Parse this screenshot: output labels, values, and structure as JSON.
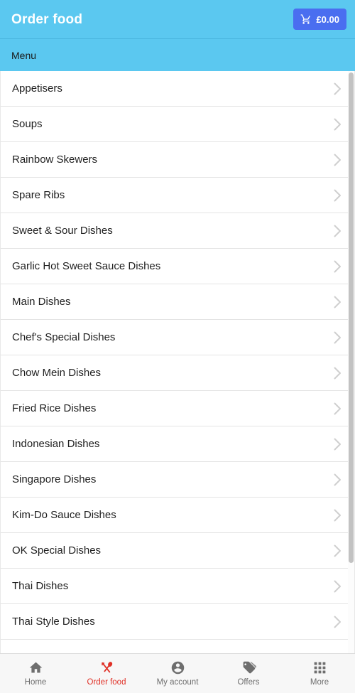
{
  "header": {
    "title": "Order food",
    "cart": {
      "icon": "shopping-cart-icon",
      "amount": "£0.00",
      "background_color": "#4a6ef0"
    },
    "background_color": "#5bc8f0"
  },
  "menu_bar": {
    "label": "Menu",
    "background_color": "#5bc8f0"
  },
  "categories": [
    {
      "label": "Appetisers",
      "chevron": "chevron-right-icon"
    },
    {
      "label": "Soups",
      "chevron": "chevron-right-icon"
    },
    {
      "label": "Rainbow Skewers",
      "chevron": "chevron-right-icon"
    },
    {
      "label": "Spare Ribs",
      "chevron": "chevron-right-icon"
    },
    {
      "label": "Sweet & Sour Dishes",
      "chevron": "chevron-right-icon"
    },
    {
      "label": "Garlic Hot Sweet Sauce Dishes",
      "chevron": "chevron-right-icon"
    },
    {
      "label": "Main Dishes",
      "chevron": "chevron-right-icon"
    },
    {
      "label": "Chef's Special Dishes",
      "chevron": "chevron-right-icon"
    },
    {
      "label": "Chow Mein Dishes",
      "chevron": "chevron-right-icon"
    },
    {
      "label": "Fried Rice Dishes",
      "chevron": "chevron-right-icon"
    },
    {
      "label": "Indonesian Dishes",
      "chevron": "chevron-right-icon"
    },
    {
      "label": "Singapore Dishes",
      "chevron": "chevron-right-icon"
    },
    {
      "label": "Kim-Do Sauce Dishes",
      "chevron": "chevron-right-icon"
    },
    {
      "label": "OK Special Dishes",
      "chevron": "chevron-right-icon"
    },
    {
      "label": "Thai Dishes",
      "chevron": "chevron-right-icon"
    },
    {
      "label": "Thai Style Dishes",
      "chevron": "chevron-right-icon"
    }
  ],
  "bottom_nav": {
    "active_color": "#e03127",
    "inactive_color": "#6e6e6e",
    "items": [
      {
        "label": "Home",
        "icon": "home-icon",
        "active": false
      },
      {
        "label": "Order food",
        "icon": "fork-spoon-icon",
        "active": true
      },
      {
        "label": "My account",
        "icon": "account-circle-icon",
        "active": false
      },
      {
        "label": "Offers",
        "icon": "tags-icon",
        "active": false
      },
      {
        "label": "More",
        "icon": "grid-apps-icon",
        "active": false
      }
    ]
  }
}
